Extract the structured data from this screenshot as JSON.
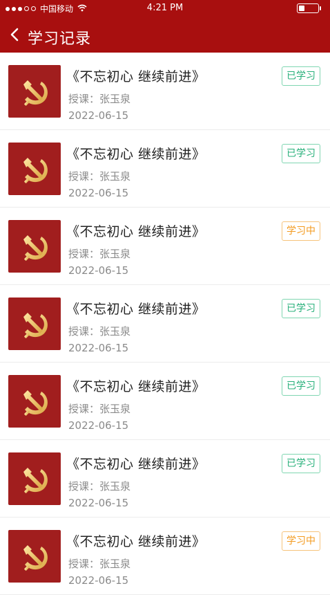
{
  "status_bar": {
    "carrier": "中国移动",
    "time": "4:21 PM"
  },
  "header": {
    "title": "学习记录"
  },
  "records": [
    {
      "title": "《不忘初心  继续前进》",
      "teacher": "授课：张玉泉",
      "date": "2022-06-15",
      "status": "已学习",
      "status_type": "done"
    },
    {
      "title": "《不忘初心  继续前进》",
      "teacher": "授课：张玉泉",
      "date": "2022-06-15",
      "status": "已学习",
      "status_type": "done"
    },
    {
      "title": "《不忘初心  继续前进》",
      "teacher": "授课：张玉泉",
      "date": "2022-06-15",
      "status": "学习中",
      "status_type": "progress"
    },
    {
      "title": "《不忘初心  继续前进》",
      "teacher": "授课：张玉泉",
      "date": "2022-06-15",
      "status": "已学习",
      "status_type": "done"
    },
    {
      "title": "《不忘初心  继续前进》",
      "teacher": "授课：张玉泉",
      "date": "2022-06-15",
      "status": "已学习",
      "status_type": "done"
    },
    {
      "title": "《不忘初心  继续前进》",
      "teacher": "授课：张玉泉",
      "date": "2022-06-15",
      "status": "已学习",
      "status_type": "done"
    },
    {
      "title": "《不忘初心  继续前进》",
      "teacher": "授课：张玉泉",
      "date": "2022-06-15",
      "status": "学习中",
      "status_type": "progress"
    }
  ],
  "colors": {
    "header_bg": "#a80f0f",
    "thumb_bg": "#a11e1e",
    "done": "#27b07a",
    "progress": "#f39a1e"
  }
}
